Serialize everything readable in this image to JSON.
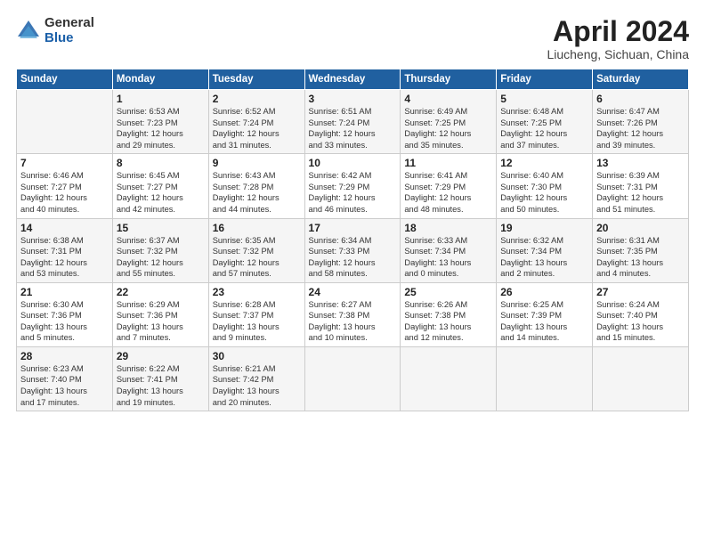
{
  "logo": {
    "general": "General",
    "blue": "Blue"
  },
  "title": "April 2024",
  "subtitle": "Liucheng, Sichuan, China",
  "headers": [
    "Sunday",
    "Monday",
    "Tuesday",
    "Wednesday",
    "Thursday",
    "Friday",
    "Saturday"
  ],
  "weeks": [
    [
      {
        "day": "",
        "content": ""
      },
      {
        "day": "1",
        "content": "Sunrise: 6:53 AM\nSunset: 7:23 PM\nDaylight: 12 hours\nand 29 minutes."
      },
      {
        "day": "2",
        "content": "Sunrise: 6:52 AM\nSunset: 7:24 PM\nDaylight: 12 hours\nand 31 minutes."
      },
      {
        "day": "3",
        "content": "Sunrise: 6:51 AM\nSunset: 7:24 PM\nDaylight: 12 hours\nand 33 minutes."
      },
      {
        "day": "4",
        "content": "Sunrise: 6:49 AM\nSunset: 7:25 PM\nDaylight: 12 hours\nand 35 minutes."
      },
      {
        "day": "5",
        "content": "Sunrise: 6:48 AM\nSunset: 7:25 PM\nDaylight: 12 hours\nand 37 minutes."
      },
      {
        "day": "6",
        "content": "Sunrise: 6:47 AM\nSunset: 7:26 PM\nDaylight: 12 hours\nand 39 minutes."
      }
    ],
    [
      {
        "day": "7",
        "content": "Sunrise: 6:46 AM\nSunset: 7:27 PM\nDaylight: 12 hours\nand 40 minutes."
      },
      {
        "day": "8",
        "content": "Sunrise: 6:45 AM\nSunset: 7:27 PM\nDaylight: 12 hours\nand 42 minutes."
      },
      {
        "day": "9",
        "content": "Sunrise: 6:43 AM\nSunset: 7:28 PM\nDaylight: 12 hours\nand 44 minutes."
      },
      {
        "day": "10",
        "content": "Sunrise: 6:42 AM\nSunset: 7:29 PM\nDaylight: 12 hours\nand 46 minutes."
      },
      {
        "day": "11",
        "content": "Sunrise: 6:41 AM\nSunset: 7:29 PM\nDaylight: 12 hours\nand 48 minutes."
      },
      {
        "day": "12",
        "content": "Sunrise: 6:40 AM\nSunset: 7:30 PM\nDaylight: 12 hours\nand 50 minutes."
      },
      {
        "day": "13",
        "content": "Sunrise: 6:39 AM\nSunset: 7:31 PM\nDaylight: 12 hours\nand 51 minutes."
      }
    ],
    [
      {
        "day": "14",
        "content": "Sunrise: 6:38 AM\nSunset: 7:31 PM\nDaylight: 12 hours\nand 53 minutes."
      },
      {
        "day": "15",
        "content": "Sunrise: 6:37 AM\nSunset: 7:32 PM\nDaylight: 12 hours\nand 55 minutes."
      },
      {
        "day": "16",
        "content": "Sunrise: 6:35 AM\nSunset: 7:32 PM\nDaylight: 12 hours\nand 57 minutes."
      },
      {
        "day": "17",
        "content": "Sunrise: 6:34 AM\nSunset: 7:33 PM\nDaylight: 12 hours\nand 58 minutes."
      },
      {
        "day": "18",
        "content": "Sunrise: 6:33 AM\nSunset: 7:34 PM\nDaylight: 13 hours\nand 0 minutes."
      },
      {
        "day": "19",
        "content": "Sunrise: 6:32 AM\nSunset: 7:34 PM\nDaylight: 13 hours\nand 2 minutes."
      },
      {
        "day": "20",
        "content": "Sunrise: 6:31 AM\nSunset: 7:35 PM\nDaylight: 13 hours\nand 4 minutes."
      }
    ],
    [
      {
        "day": "21",
        "content": "Sunrise: 6:30 AM\nSunset: 7:36 PM\nDaylight: 13 hours\nand 5 minutes."
      },
      {
        "day": "22",
        "content": "Sunrise: 6:29 AM\nSunset: 7:36 PM\nDaylight: 13 hours\nand 7 minutes."
      },
      {
        "day": "23",
        "content": "Sunrise: 6:28 AM\nSunset: 7:37 PM\nDaylight: 13 hours\nand 9 minutes."
      },
      {
        "day": "24",
        "content": "Sunrise: 6:27 AM\nSunset: 7:38 PM\nDaylight: 13 hours\nand 10 minutes."
      },
      {
        "day": "25",
        "content": "Sunrise: 6:26 AM\nSunset: 7:38 PM\nDaylight: 13 hours\nand 12 minutes."
      },
      {
        "day": "26",
        "content": "Sunrise: 6:25 AM\nSunset: 7:39 PM\nDaylight: 13 hours\nand 14 minutes."
      },
      {
        "day": "27",
        "content": "Sunrise: 6:24 AM\nSunset: 7:40 PM\nDaylight: 13 hours\nand 15 minutes."
      }
    ],
    [
      {
        "day": "28",
        "content": "Sunrise: 6:23 AM\nSunset: 7:40 PM\nDaylight: 13 hours\nand 17 minutes."
      },
      {
        "day": "29",
        "content": "Sunrise: 6:22 AM\nSunset: 7:41 PM\nDaylight: 13 hours\nand 19 minutes."
      },
      {
        "day": "30",
        "content": "Sunrise: 6:21 AM\nSunset: 7:42 PM\nDaylight: 13 hours\nand 20 minutes."
      },
      {
        "day": "",
        "content": ""
      },
      {
        "day": "",
        "content": ""
      },
      {
        "day": "",
        "content": ""
      },
      {
        "day": "",
        "content": ""
      }
    ]
  ]
}
